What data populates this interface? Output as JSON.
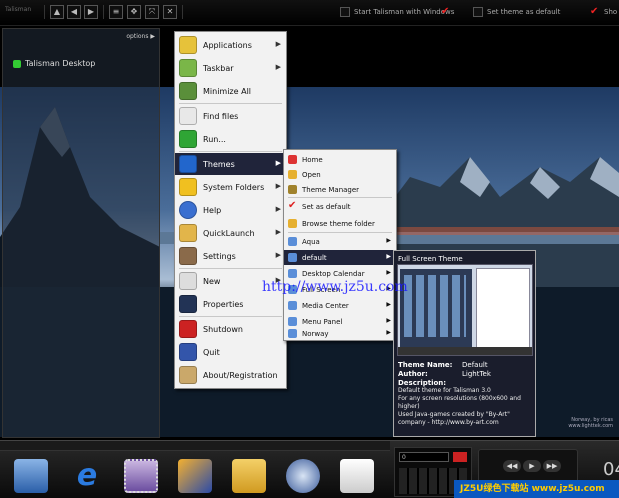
{
  "topbar": {
    "title": "Talisman",
    "options": [
      {
        "label": "Start Talisman with Windows"
      },
      {
        "label": "Set theme as default"
      },
      {
        "label": "Sho"
      }
    ]
  },
  "left_panel": {
    "header": "options ▶",
    "item": "Talisman Desktop"
  },
  "main_menu": {
    "items": [
      {
        "label": "Applications",
        "has_submenu": true
      },
      {
        "label": "Taskbar",
        "has_submenu": true
      },
      {
        "label": "Minimize All",
        "has_submenu": false
      },
      {
        "label": "Find files",
        "has_submenu": false
      },
      {
        "label": "Run...",
        "has_submenu": false
      },
      {
        "label": "Themes",
        "has_submenu": true,
        "selected": true
      },
      {
        "label": "System Folders",
        "has_submenu": true
      },
      {
        "label": "Help",
        "has_submenu": true
      },
      {
        "label": "QuickLaunch",
        "has_submenu": true
      },
      {
        "label": "Settings",
        "has_submenu": true
      },
      {
        "label": "New",
        "has_submenu": true
      },
      {
        "label": "Properties",
        "has_submenu": false
      },
      {
        "label": "Shutdown",
        "has_submenu": false
      },
      {
        "label": "Quit",
        "has_submenu": false
      },
      {
        "label": "About/Registration",
        "has_submenu": false
      }
    ]
  },
  "themes_menu": {
    "items": [
      {
        "label": "Home",
        "has_submenu": false
      },
      {
        "label": "Open",
        "has_submenu": false
      },
      {
        "label": "Theme Manager",
        "has_submenu": false
      },
      {
        "label": "Set as default",
        "has_submenu": false
      },
      {
        "label": "Browse theme folder",
        "has_submenu": false
      },
      {
        "label": "Aqua",
        "has_submenu": true
      },
      {
        "label": "default",
        "has_submenu": true,
        "selected": true
      },
      {
        "label": "Desktop Calendar",
        "has_submenu": true
      },
      {
        "label": "Full Screen",
        "has_submenu": true
      },
      {
        "label": "Media Center",
        "has_submenu": true
      },
      {
        "label": "Menu Panel",
        "has_submenu": true
      },
      {
        "label": "Norway",
        "has_submenu": true
      }
    ]
  },
  "preview": {
    "title": "Full Screen Theme",
    "name_label": "Theme Name:",
    "name_value": "Default",
    "author_label": "Author:",
    "author_value": "LightTek",
    "description_label": "Description:",
    "description_lines": [
      "Default theme for Talisman 3.0",
      "For any screen resolutions (800x600 and higher)",
      "Used Java-games created by \"By-Art\"",
      "company - http://www.by-art.com"
    ]
  },
  "watermark": "http://www.jz5u.com",
  "photo_credit": [
    "Norway, by ricas",
    "www.lighttek.com"
  ],
  "taskbar": {
    "input_value": "0",
    "clock": "04",
    "media_controls": [
      "◀◀",
      "▶",
      "▶▶"
    ],
    "apps": [
      {
        "name": "my-computer-icon"
      },
      {
        "name": "internet-explorer-icon",
        "glyph": "e"
      },
      {
        "name": "stamp-icon"
      },
      {
        "name": "winamp-icon"
      },
      {
        "name": "folder-icon"
      },
      {
        "name": "media-player-icon"
      },
      {
        "name": "notepad-icon"
      }
    ],
    "site_watermark": "JZ5U绿色下载站 www.jz5u.com"
  }
}
